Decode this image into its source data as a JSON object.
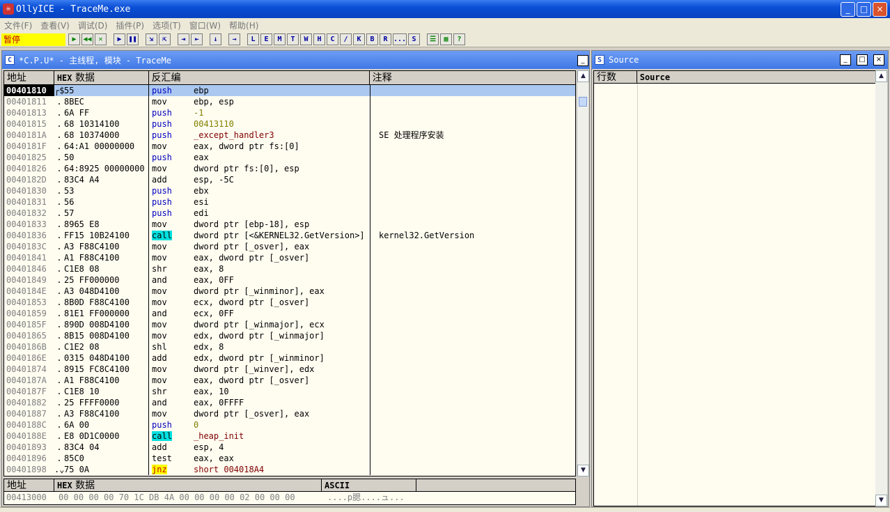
{
  "window": {
    "title": "OllyICE - TraceMe.exe",
    "logo": "olly-icon",
    "min": "_",
    "max": "□",
    "close": "×"
  },
  "menu": [
    "文件(F)",
    "查看(V)",
    "调试(D)",
    "插件(P)",
    "选项(T)",
    "窗口(W)",
    "帮助(H)"
  ],
  "toolbar": {
    "state": "暂停",
    "buttons": [
      "▶",
      "◀◀",
      "✕",
      "▶",
      "❚❚",
      "⇲",
      "⇱",
      "⇥",
      "⇤",
      "↓",
      "→"
    ],
    "letters": [
      "L",
      "E",
      "M",
      "T",
      "W",
      "H",
      "C",
      "/",
      "K",
      "B",
      "R",
      "...",
      "S"
    ],
    "extra": [
      "☰",
      "▦",
      "?"
    ]
  },
  "cpu": {
    "title": "*C.P.U* -  主线程, 模块 - TraceMe",
    "icon": "C",
    "headers": {
      "addr": "地址",
      "hex": "HEX",
      "data": "数据",
      "disasm": "反汇编",
      "comment": "注释"
    },
    "rows": [
      {
        "a": "00401810",
        "m": "┌$",
        "h": "55",
        "mn": "push",
        "ops": "ebp",
        "cm": "",
        "sel": true
      },
      {
        "a": "00401811",
        "m": ".",
        "h": "8BEC",
        "mn": "mov",
        "ops": "ebp, esp",
        "cm": ""
      },
      {
        "a": "00401813",
        "m": ".",
        "h": "6A FF",
        "mn": "push",
        "ops": "-1",
        "cm": ""
      },
      {
        "a": "00401815",
        "m": ".",
        "h": "68 10314100",
        "mn": "push",
        "ops": "00413110",
        "cm": ""
      },
      {
        "a": "0040181A",
        "m": ".",
        "h": "68 10374000",
        "mn": "push",
        "ops": "_except_handler3",
        "cm": "SE 处理程序安装"
      },
      {
        "a": "0040181F",
        "m": ".",
        "h": "64:A1 00000000",
        "mn": "mov",
        "ops": "eax, dword ptr fs:[0]",
        "cm": ""
      },
      {
        "a": "00401825",
        "m": ".",
        "h": "50",
        "mn": "push",
        "ops": "eax",
        "cm": ""
      },
      {
        "a": "00401826",
        "m": ".",
        "h": "64:8925 00000000",
        "mn": "mov",
        "ops": "dword ptr fs:[0], esp",
        "cm": ""
      },
      {
        "a": "0040182D",
        "m": ".",
        "h": "83C4 A4",
        "mn": "add",
        "ops": "esp, -5C",
        "cm": ""
      },
      {
        "a": "00401830",
        "m": ".",
        "h": "53",
        "mn": "push",
        "ops": "ebx",
        "cm": ""
      },
      {
        "a": "00401831",
        "m": ".",
        "h": "56",
        "mn": "push",
        "ops": "esi",
        "cm": ""
      },
      {
        "a": "00401832",
        "m": ".",
        "h": "57",
        "mn": "push",
        "ops": "edi",
        "cm": ""
      },
      {
        "a": "00401833",
        "m": ".",
        "h": "8965 E8",
        "mn": "mov",
        "ops": "dword ptr [ebp-18], esp",
        "cm": ""
      },
      {
        "a": "00401836",
        "m": ".",
        "h": "FF15 10B24100",
        "mn": "call",
        "ops": "dword ptr [<&KERNEL32.GetVersion>]",
        "cm": "kernel32.GetVersion"
      },
      {
        "a": "0040183C",
        "m": ".",
        "h": "A3 F88C4100",
        "mn": "mov",
        "ops": "dword ptr [_osver], eax",
        "cm": ""
      },
      {
        "a": "00401841",
        "m": ".",
        "h": "A1 F88C4100",
        "mn": "mov",
        "ops": "eax, dword ptr [_osver]",
        "cm": ""
      },
      {
        "a": "00401846",
        "m": ".",
        "h": "C1E8 08",
        "mn": "shr",
        "ops": "eax, 8",
        "cm": ""
      },
      {
        "a": "00401849",
        "m": ".",
        "h": "25 FF000000",
        "mn": "and",
        "ops": "eax, 0FF",
        "cm": ""
      },
      {
        "a": "0040184E",
        "m": ".",
        "h": "A3 048D4100",
        "mn": "mov",
        "ops": "dword ptr [_winminor], eax",
        "cm": ""
      },
      {
        "a": "00401853",
        "m": ".",
        "h": "8B0D F88C4100",
        "mn": "mov",
        "ops": "ecx, dword ptr [_osver]",
        "cm": ""
      },
      {
        "a": "00401859",
        "m": ".",
        "h": "81E1 FF000000",
        "mn": "and",
        "ops": "ecx, 0FF",
        "cm": ""
      },
      {
        "a": "0040185F",
        "m": ".",
        "h": "890D 008D4100",
        "mn": "mov",
        "ops": "dword ptr [_winmajor], ecx",
        "cm": ""
      },
      {
        "a": "00401865",
        "m": ".",
        "h": "8B15 008D4100",
        "mn": "mov",
        "ops": "edx, dword ptr [_winmajor]",
        "cm": ""
      },
      {
        "a": "0040186B",
        "m": ".",
        "h": "C1E2 08",
        "mn": "shl",
        "ops": "edx, 8",
        "cm": ""
      },
      {
        "a": "0040186E",
        "m": ".",
        "h": "0315 048D4100",
        "mn": "add",
        "ops": "edx, dword ptr [_winminor]",
        "cm": ""
      },
      {
        "a": "00401874",
        "m": ".",
        "h": "8915 FC8C4100",
        "mn": "mov",
        "ops": "dword ptr [_winver], edx",
        "cm": ""
      },
      {
        "a": "0040187A",
        "m": ".",
        "h": "A1 F88C4100",
        "mn": "mov",
        "ops": "eax, dword ptr [_osver]",
        "cm": ""
      },
      {
        "a": "0040187F",
        "m": ".",
        "h": "C1E8 10",
        "mn": "shr",
        "ops": "eax, 10",
        "cm": ""
      },
      {
        "a": "00401882",
        "m": ".",
        "h": "25 FFFF0000",
        "mn": "and",
        "ops": "eax, 0FFFF",
        "cm": ""
      },
      {
        "a": "00401887",
        "m": ".",
        "h": "A3 F88C4100",
        "mn": "mov",
        "ops": "dword ptr [_osver], eax",
        "cm": ""
      },
      {
        "a": "0040188C",
        "m": ".",
        "h": "6A 00",
        "mn": "push",
        "ops": "0",
        "cm": ""
      },
      {
        "a": "0040188E",
        "m": ".",
        "h": "E8 0D1C0000",
        "mn": "call",
        "ops": "_heap_init",
        "cm": ""
      },
      {
        "a": "00401893",
        "m": ".",
        "h": "83C4 04",
        "mn": "add",
        "ops": "esp, 4",
        "cm": ""
      },
      {
        "a": "00401896",
        "m": ".",
        "h": "85C0",
        "mn": "test",
        "ops": "eax, eax",
        "cm": ""
      },
      {
        "a": "00401898",
        "m": ".⌄",
        "h": "75 0A",
        "mn": "jnz",
        "ops": "short 004018A4",
        "cm": ""
      }
    ]
  },
  "dump": {
    "headers": {
      "addr": "地址",
      "hex": "HEX",
      "data": "数据",
      "ascii": "ASCII"
    },
    "row": {
      "addr": "00413000",
      "hex": "00 00 00 00 70 1C DB 4A 00 00 00 00 02 00 00 00",
      "ascii": "....p腮....ュ..."
    }
  },
  "source": {
    "title": "Source",
    "icon": "S",
    "col1": "行数",
    "col2": "Source"
  }
}
